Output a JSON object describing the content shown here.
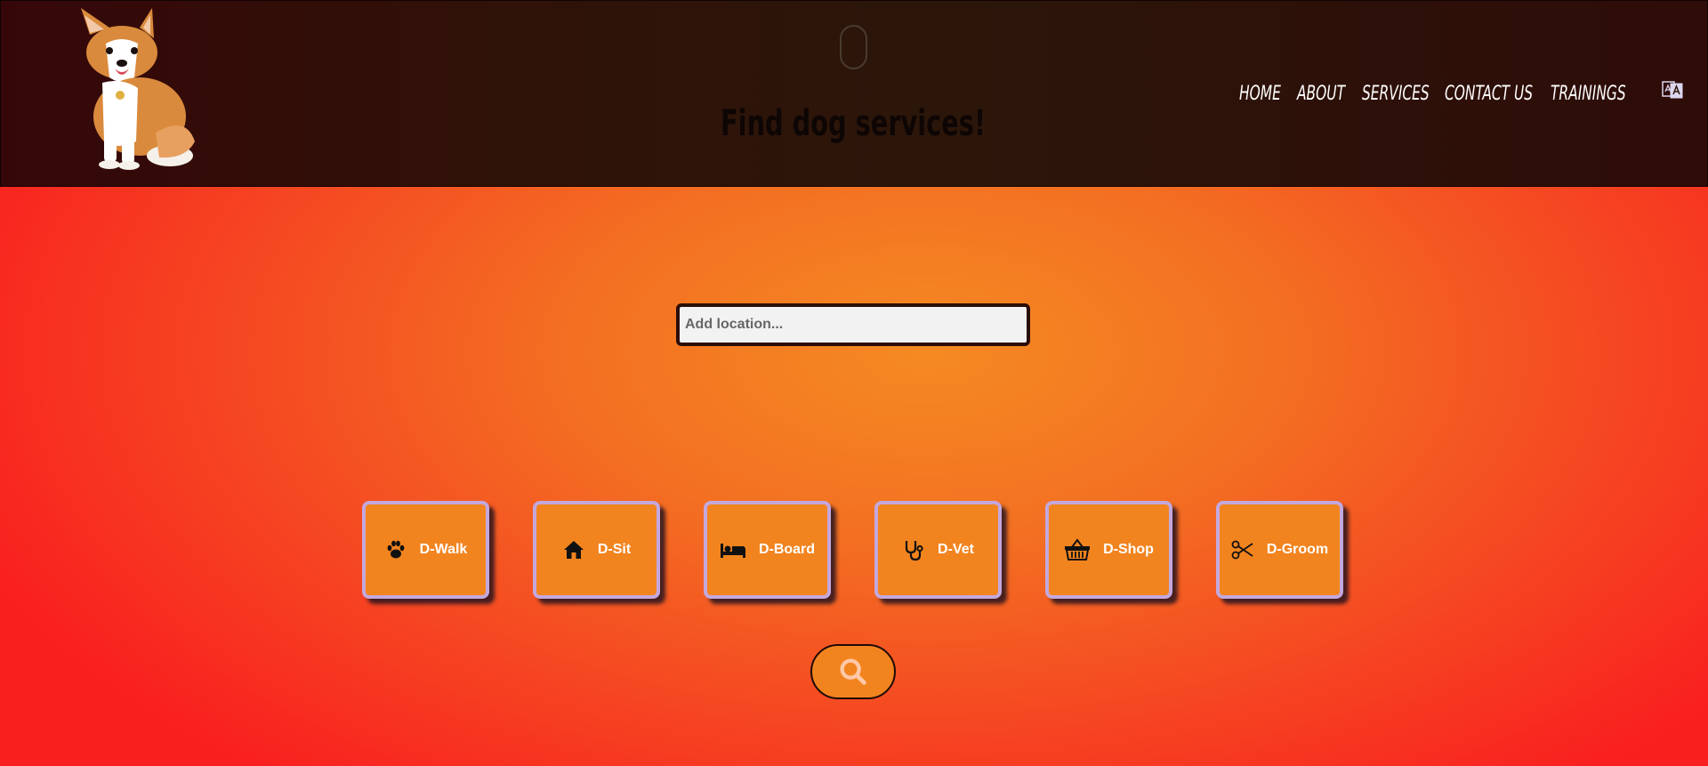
{
  "header": {
    "title": "Find dog services!",
    "nav": [
      {
        "label": "HOME"
      },
      {
        "label": "ABOUT"
      },
      {
        "label": "SERVICES"
      },
      {
        "label": "CONTACT US"
      },
      {
        "label": "TRAININGS"
      }
    ]
  },
  "search": {
    "placeholder": "Add location...",
    "value": ""
  },
  "services": [
    {
      "label": "D-Walk",
      "icon": "paw-icon"
    },
    {
      "label": "D-Sit",
      "icon": "home-icon"
    },
    {
      "label": "D-Board",
      "icon": "bed-icon"
    },
    {
      "label": "D-Vet",
      "icon": "stethoscope-icon"
    },
    {
      "label": "D-Shop",
      "icon": "basket-icon"
    },
    {
      "label": "D-Groom",
      "icon": "scissors-icon"
    }
  ],
  "colors": {
    "header_bg": "#2c160a",
    "button_bg": "#f2841f",
    "button_border": "#c4a8dc",
    "accent_red": "#f91f1f",
    "accent_orange": "#f58a22"
  }
}
